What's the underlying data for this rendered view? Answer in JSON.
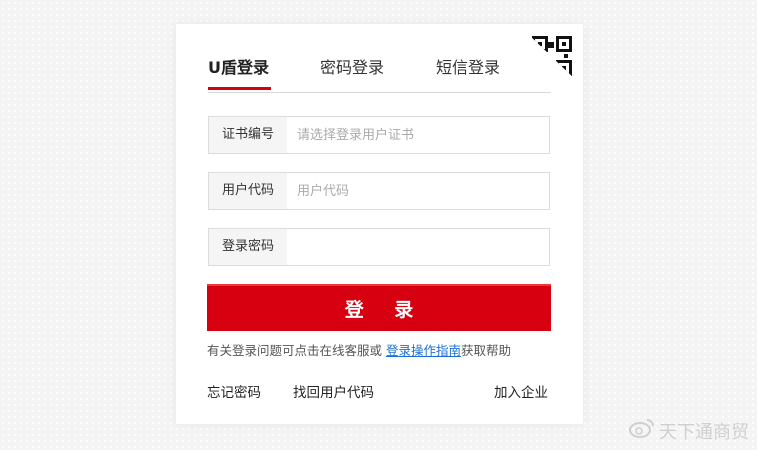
{
  "tabs": [
    {
      "label": "U盾登录",
      "active": true
    },
    {
      "label": "密码登录",
      "active": false
    },
    {
      "label": "短信登录",
      "active": false
    }
  ],
  "fields": {
    "cert": {
      "label": "证书编号",
      "placeholder": "请选择登录用户证书",
      "value": ""
    },
    "user_code": {
      "label": "用户代码",
      "placeholder": "用户代码",
      "value": ""
    },
    "password": {
      "label": "登录密码",
      "placeholder": "",
      "value": ""
    }
  },
  "login_button": "登 录",
  "help": {
    "prefix": "有关登录问题可点击在线客服或 ",
    "link": "登录操作指南",
    "suffix": "获取帮助"
  },
  "links": {
    "forgot_password": "忘记密码",
    "retrieve_user_code": "找回用户代码",
    "join_company": "加入企业"
  },
  "watermark": "天下通商贸",
  "colors": {
    "accent": "#d70010",
    "link": "#1a6fd6"
  },
  "icons": {
    "qr": "qr-code-icon",
    "weibo": "weibo-icon"
  }
}
